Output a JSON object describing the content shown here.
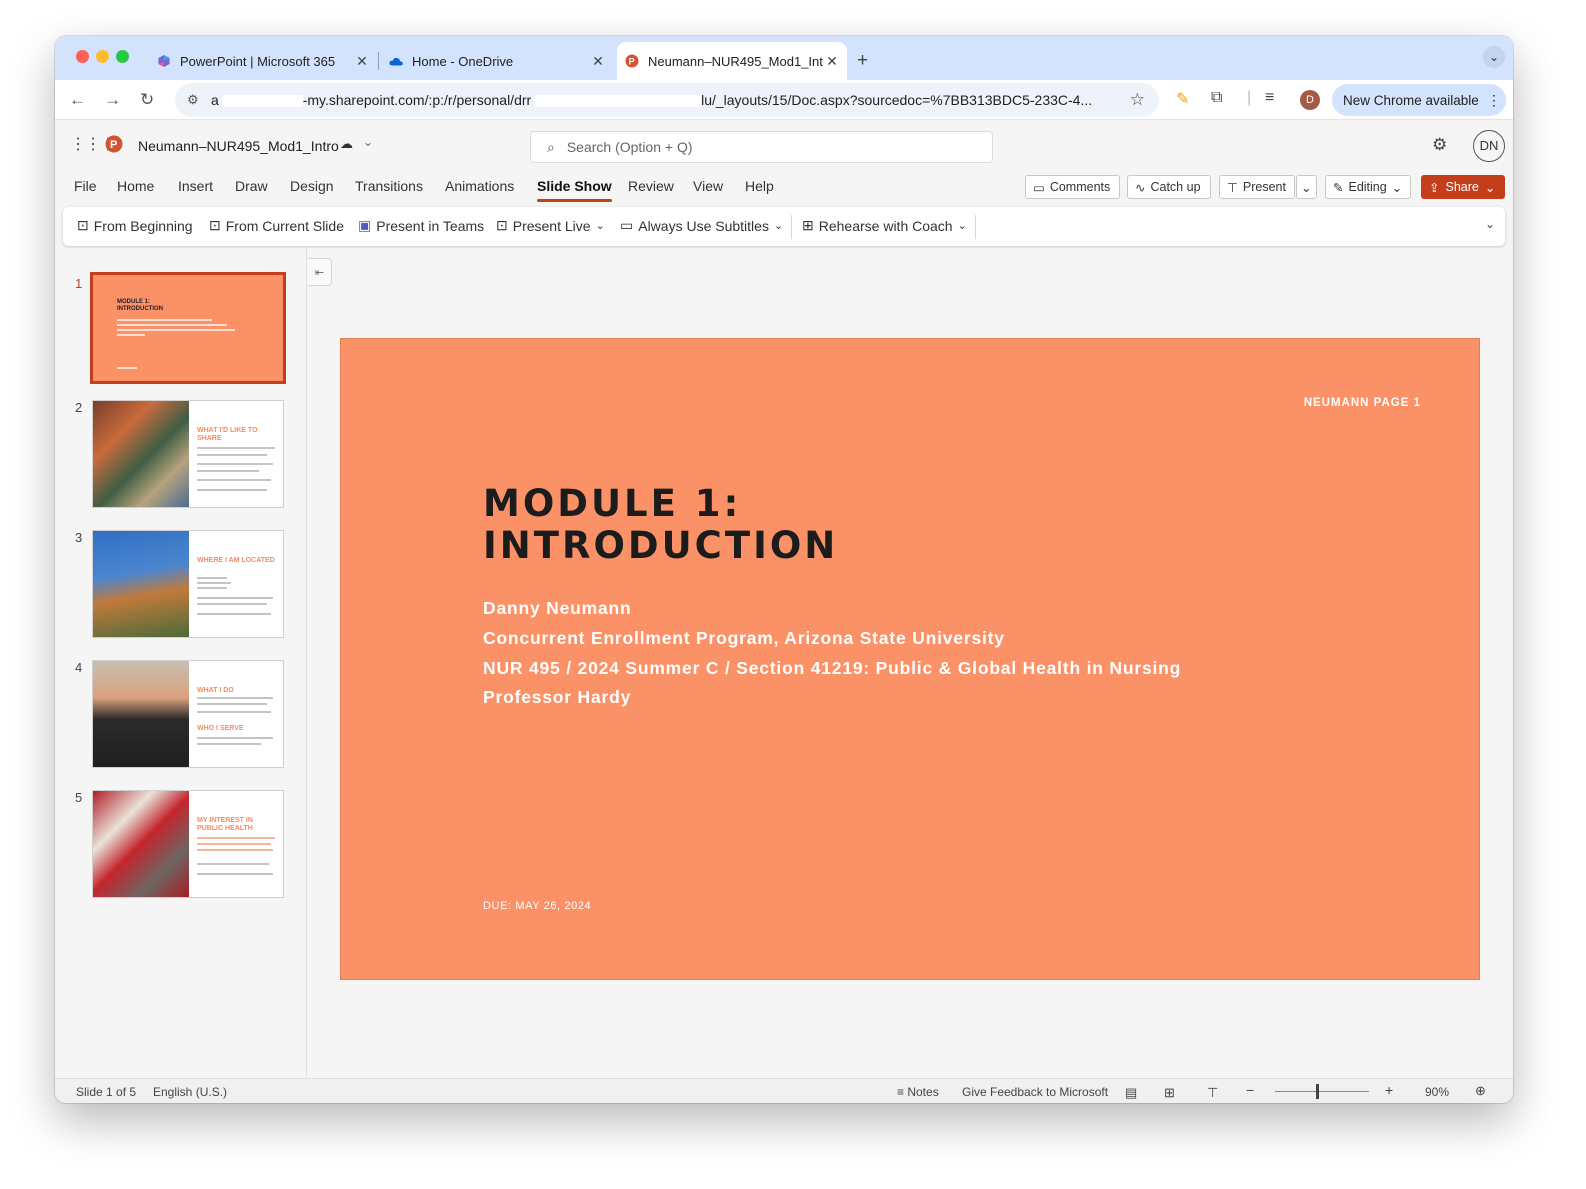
{
  "browser": {
    "tabs": [
      {
        "title": "PowerPoint | Microsoft 365"
      },
      {
        "title": "Home - OneDrive"
      },
      {
        "title": "Neumann–NUR495_Mod1_Intro"
      }
    ],
    "url_prefix": "a",
    "url_middle": "-my.sharepoint.com/:p:/r/personal/drr",
    "url_suffix": "lu/_layouts/15/Doc.aspx?sourcedoc=%7BB313BDC5-233C-4...",
    "profile_initial": "D",
    "update_button": "New Chrome available"
  },
  "app": {
    "file_name": "Neumann–NUR495_Mod1_Intro",
    "search_placeholder": "Search (Option + Q)",
    "user_initials": "DN",
    "menus": [
      "File",
      "Home",
      "Insert",
      "Draw",
      "Design",
      "Transitions",
      "Animations",
      "Slide Show",
      "Review",
      "View",
      "Help"
    ],
    "actions": {
      "comments": "Comments",
      "catch_up": "Catch up",
      "present": "Present",
      "editing": "Editing",
      "share": "Share"
    },
    "ribbon": {
      "from_beginning": "From Beginning",
      "from_current": "From Current Slide",
      "present_teams": "Present in Teams",
      "present_live": "Present Live",
      "subtitles": "Always Use Subtitles",
      "rehearse": "Rehearse with Coach"
    }
  },
  "thumbnails": [
    {
      "number": "1",
      "title": "MODULE 1: INTRODUCTION"
    },
    {
      "number": "2",
      "title": "WHAT I'D LIKE TO SHARE"
    },
    {
      "number": "3",
      "title": "WHERE I AM LOCATED"
    },
    {
      "number": "4",
      "title": "WHAT I DO",
      "subtitle": "WHO I SERVE"
    },
    {
      "number": "5",
      "title": "MY INTEREST IN PUBLIC HEALTH"
    }
  ],
  "slide": {
    "page_label": "NEUMANN PAGE 1",
    "title_line1": "MODULE 1:",
    "title_line2": "INTRODUCTION",
    "author": "Danny Neumann",
    "program": "Concurrent Enrollment Program, Arizona State University",
    "course": "NUR 495 / 2024 Summer C / Section 41219: Public & Global Health in Nursing",
    "professor": "Professor Hardy",
    "due": "DUE: MAY 26, 2024",
    "background_color": "#fb9167"
  },
  "status": {
    "slide_count": "Slide 1 of 5",
    "language": "English (U.S.)",
    "notes": "Notes",
    "feedback": "Give Feedback to Microsoft",
    "zoom_percent": "90%",
    "zoom_level": 0.45
  },
  "colors": {
    "accent": "#c43e1c",
    "tab_strip": "#d3e3fd"
  }
}
